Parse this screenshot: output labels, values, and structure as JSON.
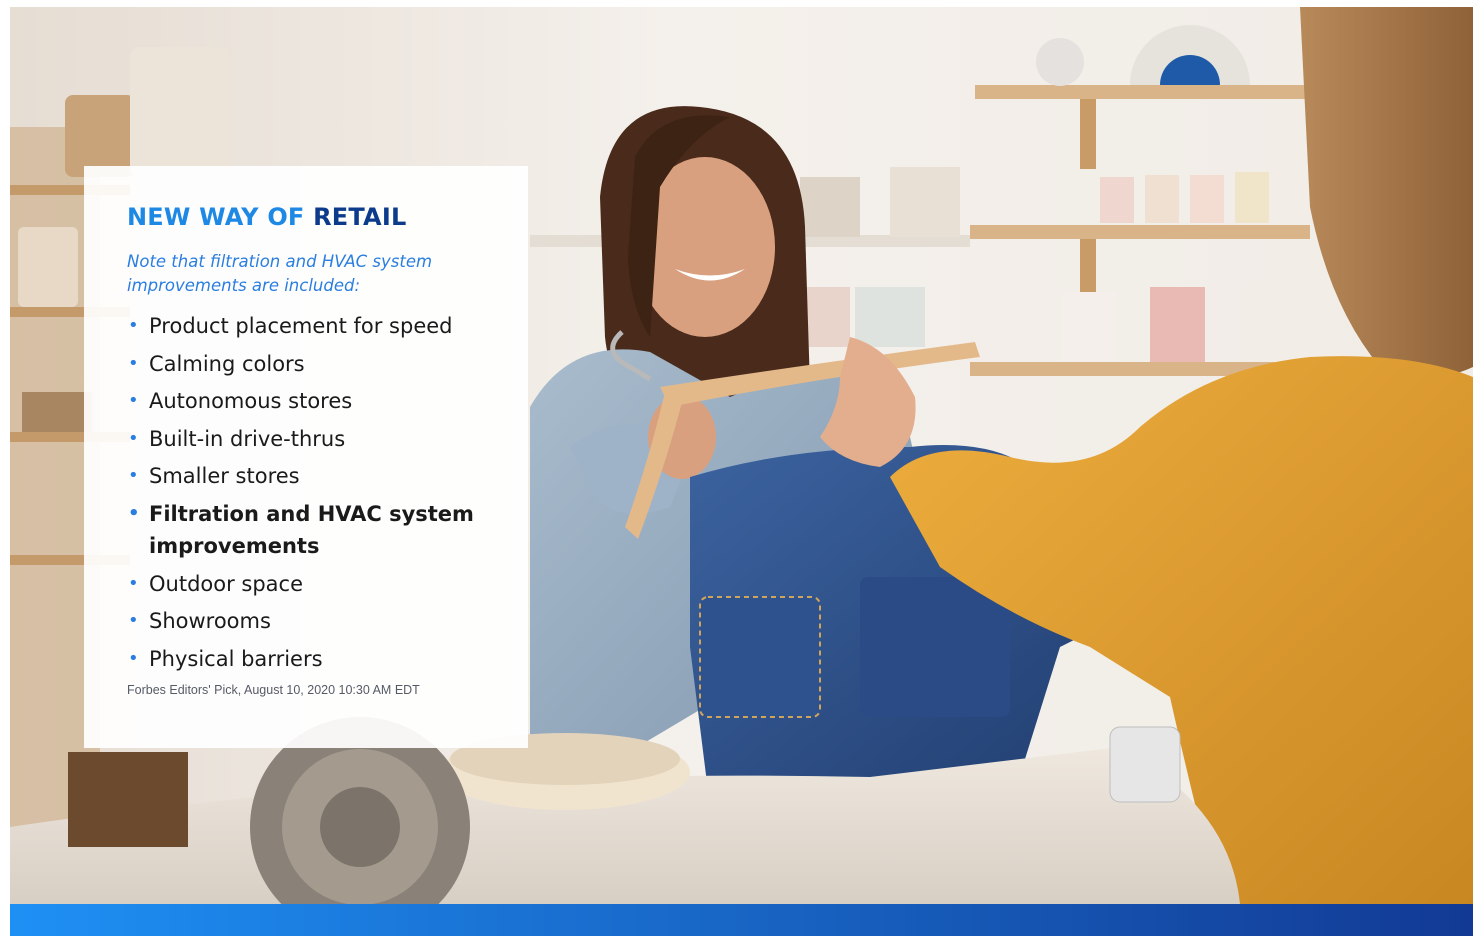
{
  "card": {
    "headline_lead": "NEW WAY OF ",
    "headline_strong": "RETAIL",
    "note": "Note that filtration and HVAC system improvements are included:",
    "bullets": [
      {
        "text": "Product placement for speed",
        "emphasis": false
      },
      {
        "text": "Calming colors",
        "emphasis": false
      },
      {
        "text": "Autonomous stores",
        "emphasis": false
      },
      {
        "text": "Built-in drive-thrus",
        "emphasis": false
      },
      {
        "text": "Smaller stores",
        "emphasis": false
      },
      {
        "text": "Filtration and HVAC system improvements",
        "emphasis": true
      },
      {
        "text": "Outdoor space",
        "emphasis": false
      },
      {
        "text": "Showrooms",
        "emphasis": false
      },
      {
        "text": "Physical barriers",
        "emphasis": false
      }
    ],
    "bullet_glyph": "•",
    "source": "Forbes Editors' Pick, August 10, 2020 10:30 AM EDT"
  },
  "colors": {
    "headline_lead": "#1e88e5",
    "headline_strong": "#0d3b8c",
    "accent": "#2a7ee0",
    "bar_start": "#1e90f5",
    "bar_end": "#123a94",
    "sweater": "#e2a033",
    "denim": "#2e4f86"
  },
  "photo": {
    "description_icon": "retail-checkout-photo"
  }
}
